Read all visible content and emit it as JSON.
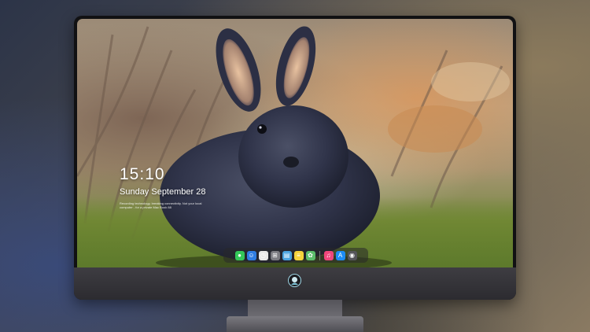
{
  "lock_screen": {
    "time": "15:10",
    "date": "Sunday September 28",
    "note": "Recording technology, breaking connectivity. Not your local computer - for a private Mac Book 88"
  },
  "dock": {
    "items": [
      {
        "name": "messages-icon",
        "color": "#34c759",
        "glyph": "●"
      },
      {
        "name": "finder-icon",
        "color": "#2f7de1",
        "glyph": "☺"
      },
      {
        "name": "clock-icon",
        "color": "#e8e8e8",
        "glyph": "◷"
      },
      {
        "name": "launchpad-icon",
        "color": "#7c7c82",
        "glyph": "⊞"
      },
      {
        "name": "clapper-icon",
        "color": "#4aa3df",
        "glyph": "▤"
      },
      {
        "name": "notes-icon",
        "color": "#f5d33b",
        "glyph": "≡"
      },
      {
        "name": "photos-icon",
        "color": "#5bbd6a",
        "glyph": "✿"
      },
      {
        "name": "music-icon",
        "color": "#f0467b",
        "glyph": "♫"
      },
      {
        "name": "app-store-icon",
        "color": "#1d8cf5",
        "glyph": "A"
      },
      {
        "name": "camera-icon",
        "color": "#55555a",
        "glyph": "◉"
      }
    ]
  },
  "colors": {
    "bezel": "#111113",
    "chin": "#343338",
    "stand": "#6a696e"
  }
}
